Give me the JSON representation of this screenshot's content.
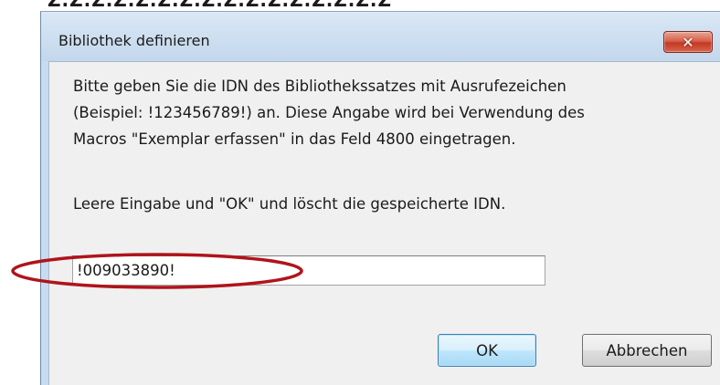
{
  "background_window": {
    "partial_text": "Z.Z.Z.Z.Z.Z.Z.Z.Z.Z.Z.Z.Z.Z.Z.Z"
  },
  "dialog": {
    "title": "Bibliothek definieren",
    "close_glyph": "✕",
    "message_lines": [
      "Bitte geben Sie die IDN des Bibliothekssatzes mit Ausrufezeichen",
      "(Beispiel: !123456789!) an. Diese Angabe wird bei Verwendung des",
      "Macros \"Exemplar erfassen\" in das Feld 4800 eingetragen."
    ],
    "hint": "Leere Eingabe und \"OK\" und löscht die gespeicherte IDN.",
    "input_value": "!009033890!",
    "ok_label": "OK",
    "cancel_label": "Abbrechen"
  },
  "colors": {
    "annotation": "#b0141b",
    "close_button": "#c8432c",
    "frame": "#c9dcef",
    "content_background": "#f0f0f0"
  },
  "icons": {
    "close": "close-icon"
  }
}
